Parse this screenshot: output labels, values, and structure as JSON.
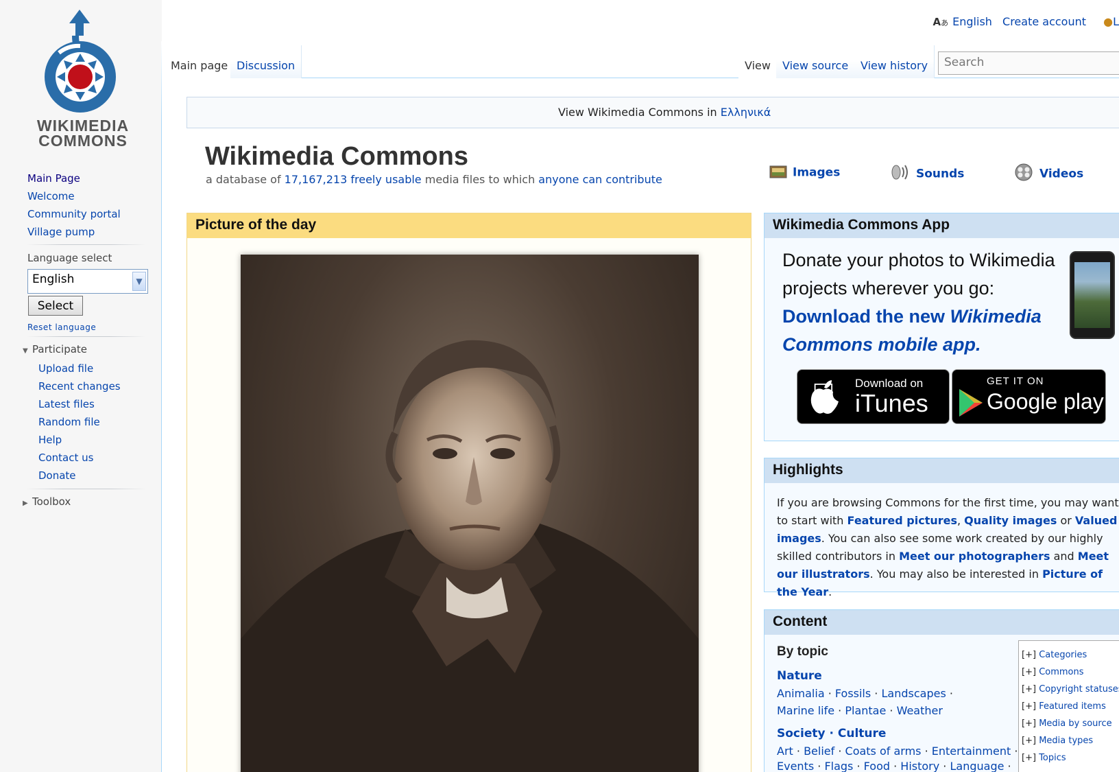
{
  "logo": {
    "line1": "WIKIMEDIA",
    "line2": "COMMONS"
  },
  "sidebar": {
    "main_links": [
      "Main Page",
      "Welcome",
      "Community portal",
      "Village pump"
    ],
    "language_select_label": "Language select",
    "language_value": "English",
    "select_button": "Select",
    "reset_language": "Reset language",
    "participate_label": "Participate",
    "participate_links": [
      "Upload file",
      "Recent changes",
      "Latest files",
      "Random file",
      "Help",
      "Contact us",
      "Donate"
    ],
    "toolbox_label": "Toolbox"
  },
  "personal": {
    "language": "English",
    "create_account": "Create account",
    "login_partial": "L"
  },
  "tabs": {
    "main_page": "Main page",
    "discussion": "Discussion",
    "view": "View",
    "view_source": "View source",
    "view_history": "View history"
  },
  "search": {
    "placeholder": "Search"
  },
  "notice": {
    "text": "View Wikimedia Commons in ",
    "link": "Ελληνικά"
  },
  "header": {
    "title": "Wikimedia Commons",
    "sub_1": "a database of ",
    "count": "17,167,213",
    "sub_2": " ",
    "freely_usable": "freely usable",
    "sub_3": " media files to which ",
    "contribute": "anyone can contribute"
  },
  "media_links": {
    "images": "Images",
    "sounds": "Sounds",
    "videos": "Videos"
  },
  "potd": {
    "title": "Picture of the day"
  },
  "app": {
    "title": "Wikimedia Commons App",
    "text": "Donate your photos to Wikimedia projects wherever you go:",
    "download_1": "Download the new ",
    "download_2": "Wikimedia Commons mobile app.",
    "itunes_top": "Download on",
    "itunes_main": "iTunes",
    "gplay_top": "GET IT ON",
    "gplay_main": "Google play"
  },
  "highlights": {
    "title": "Highlights",
    "t1": "If you are browsing Commons for the first time, you may want to start with ",
    "featured": "Featured pictures",
    "t2": ", ",
    "quality": "Quality images",
    "t3": " or ",
    "valued": "Valued images",
    "t4": ". You can also see some work created by our highly skilled contributors in ",
    "photographers": "Meet our photographers",
    "t5": " and ",
    "illustrators": "Meet our illustrators",
    "t6": ". You may also be interested in ",
    "poty": "Picture of the Year",
    "t7": "."
  },
  "content": {
    "title": "Content",
    "by_topic": "By topic",
    "nature": "Nature",
    "nature_items": [
      "Animalia",
      "Fossils",
      "Landscapes",
      "Marine life",
      "Plantae",
      "Weather"
    ],
    "society": "Society",
    "culture": "Culture",
    "society_items": [
      "Art",
      "Belief",
      "Coats of arms",
      "Entertainment"
    ],
    "society_items_2": [
      "Events",
      "Flags",
      "Food",
      "History",
      "Language"
    ],
    "tree_marker": "[+]",
    "tree": [
      "Categories",
      "Commons",
      "Copyright statuses",
      "Featured items",
      "Media by source",
      "Media types",
      "Topics"
    ]
  },
  "colors": {
    "link": "#0645ad",
    "potd_head": "#fbdc80",
    "box_head": "#cee0f2",
    "border": "#a7d7f9"
  }
}
